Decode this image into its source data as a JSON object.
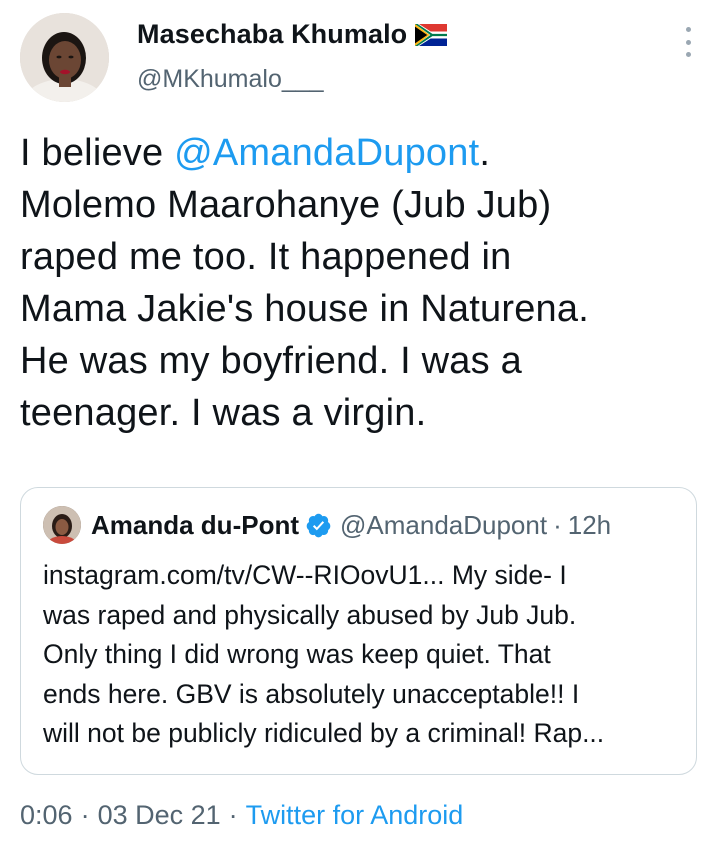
{
  "author": {
    "display_name": "Masechaba Khumalo",
    "flag_icon": "south-africa-flag-icon",
    "handle": "@MKhumalo___"
  },
  "tweet": {
    "mention": "@AmandaDupont",
    "text_before": "I believe ",
    "text_after": ".\nMolemo Maarohanye (Jub Jub)\nraped me too. It happened in\nMama Jakie's house in Naturena.\nHe was my boyfriend. I was a\nteenager. I was a virgin."
  },
  "quote": {
    "display_name": "Amanda du-Pont",
    "verified_icon": "verified-badge-icon",
    "handle": "@AmandaDupont",
    "separator": "·",
    "time": "12h",
    "text": "instagram.com/tv/CW--RIOovU1... My side- I\nwas raped and physically abused by Jub Jub.\nOnly thing I did wrong was keep quiet. That\nends here. GBV is absolutely unacceptable!! I\nwill not be publicly ridiculed by a criminal! Rap..."
  },
  "meta": {
    "time": "0:06",
    "separator": "·",
    "date": "03 Dec 21",
    "source": "Twitter for Android"
  },
  "colors": {
    "link": "#1d9bf0",
    "secondary_text": "#536471",
    "border": "#cfd9de"
  }
}
